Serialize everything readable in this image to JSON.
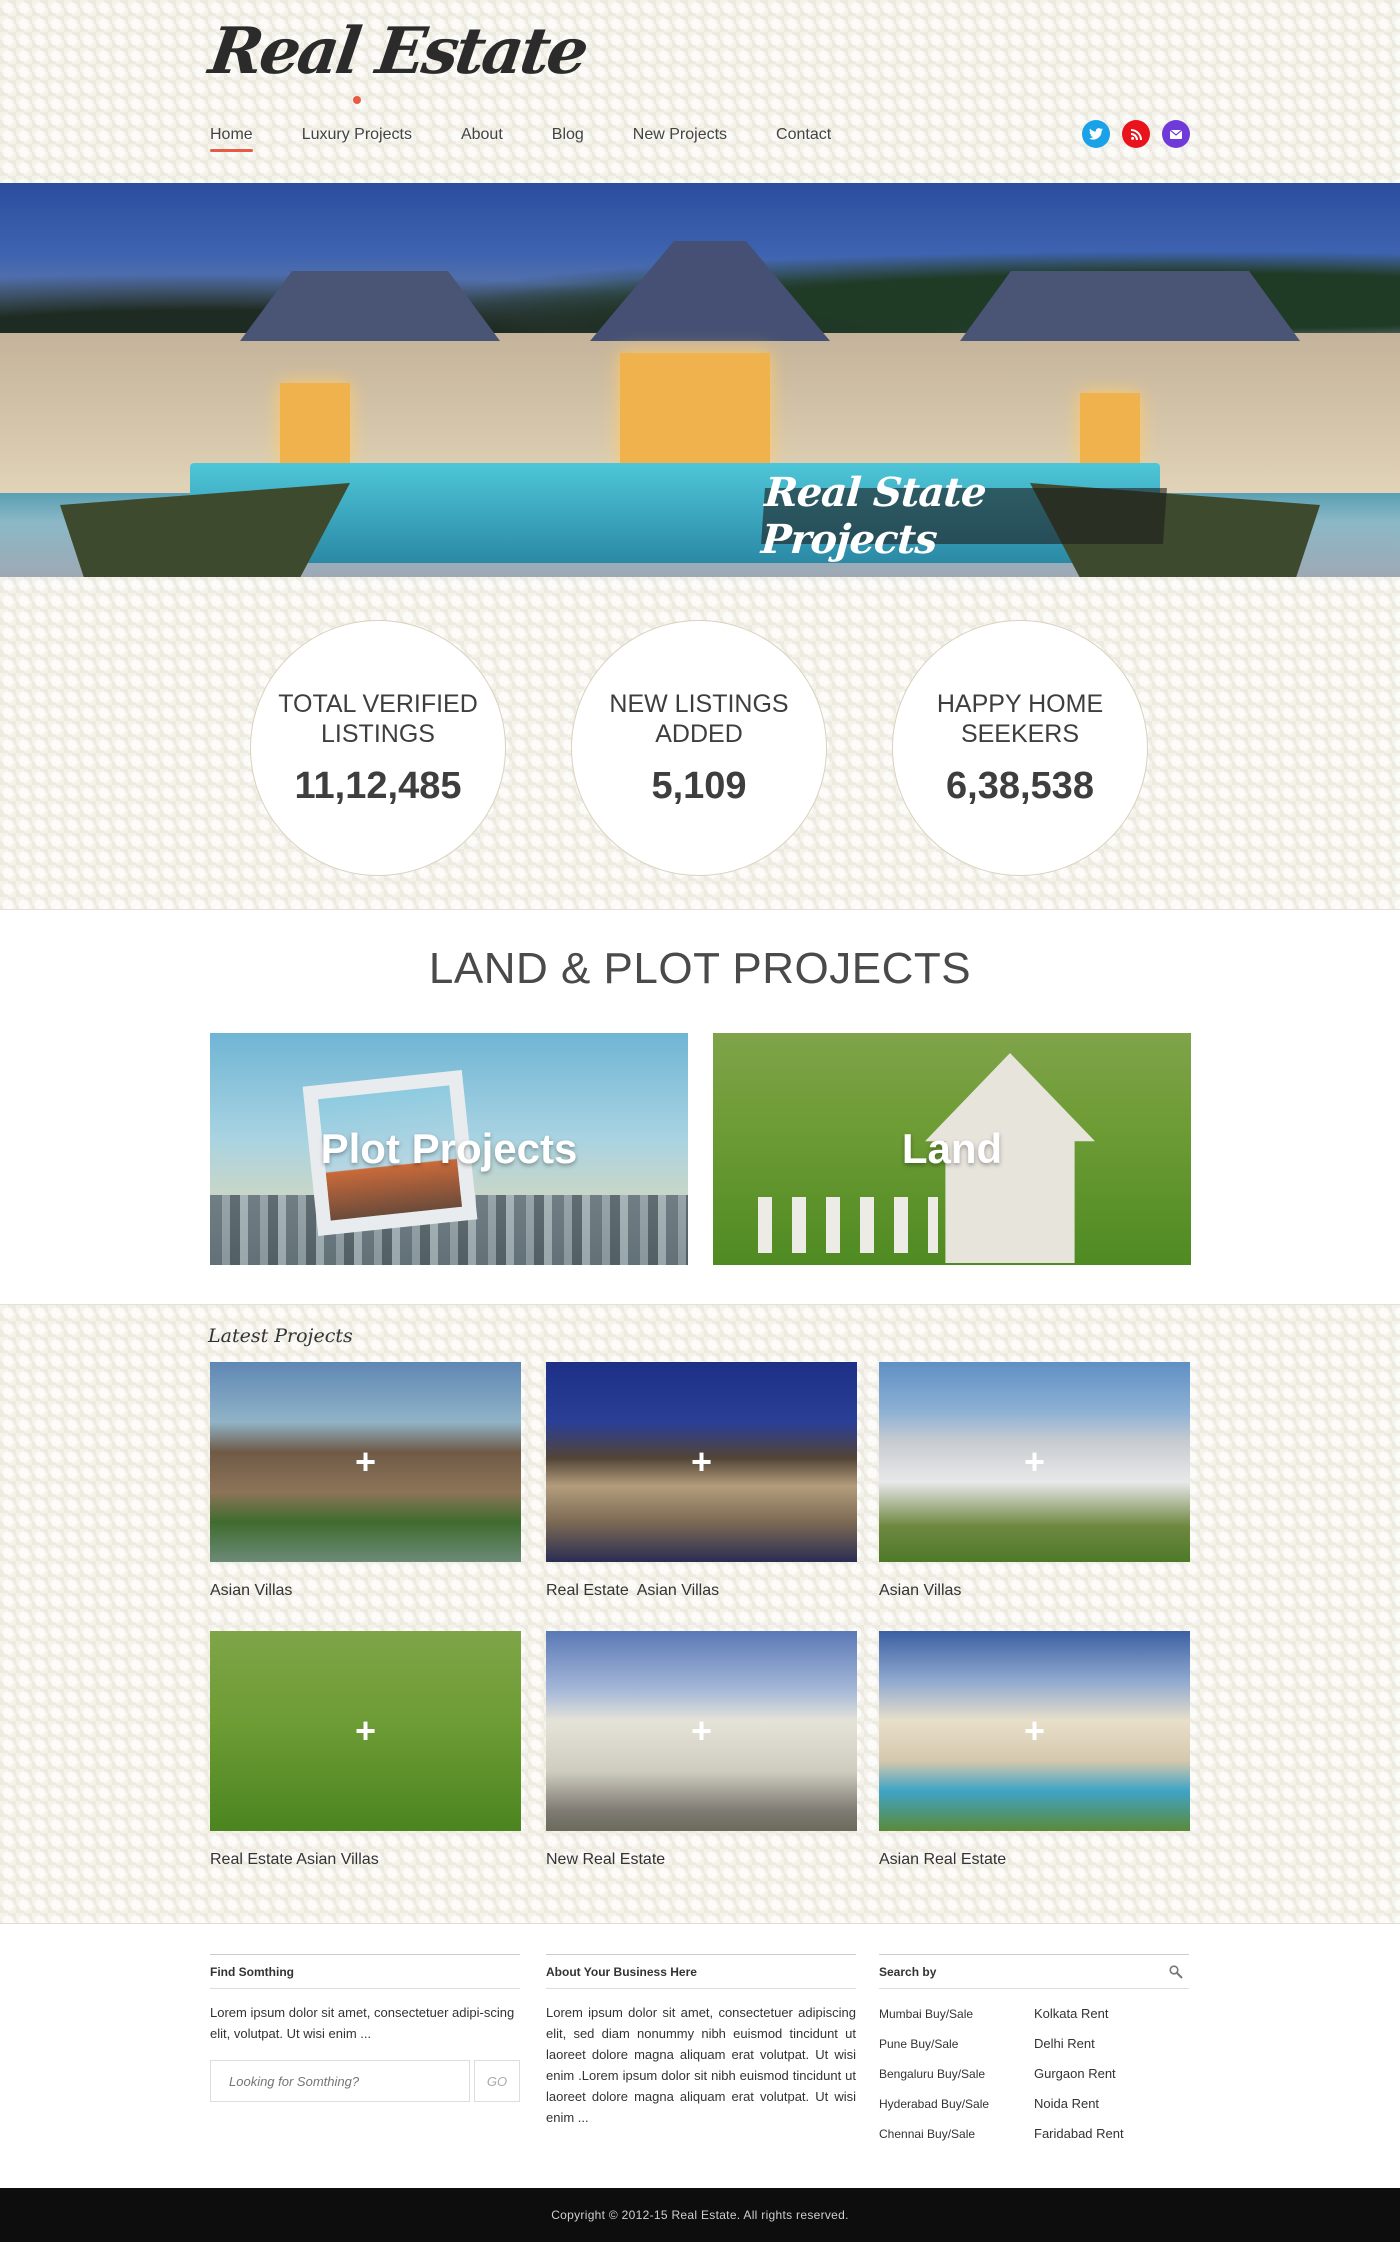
{
  "brand": {
    "logo": "Real Estate"
  },
  "nav": {
    "items": [
      "Home",
      "Luxury Projects",
      "About",
      "Blog",
      "New Projects",
      "Contact"
    ],
    "active": "Home"
  },
  "social": [
    "twitter-icon",
    "rss-icon",
    "mail-icon"
  ],
  "colors": {
    "accent": "#e85a42",
    "twitter": "#1aa2e8",
    "rss": "#e8131b",
    "mail": "#6f3ad8",
    "footer": "#0d0d0d"
  },
  "hero": {
    "banner": "Real State Projects"
  },
  "stats": [
    {
      "label": "TOTAL VERIFIED LISTINGS",
      "value": "11,12,485"
    },
    {
      "label": "NEW LISTINGS ADDED",
      "value": "5,109"
    },
    {
      "label": "HAPPY HOME SEEKERS",
      "value": "6,38,538"
    }
  ],
  "land_section": {
    "heading": "LAND & PLOT PROJECTS",
    "cards": [
      "Plot Projects",
      "Land"
    ]
  },
  "latest": {
    "heading": "Latest Projects",
    "items": [
      "Asian Villas",
      "Real Estate  Asian Villas",
      "Asian Villas",
      "Real Estate Asian Villas",
      "New Real Estate",
      "Asian Real Estate"
    ]
  },
  "footer": {
    "find": {
      "title": "Find Somthing",
      "text": "Lorem ipsum dolor sit amet, consectetuer adipi-scing elit, volutpat. Ut wisi enim ...",
      "placeholder": "Looking for Somthing?",
      "go": "GO"
    },
    "about": {
      "title": "About Your Business Here",
      "text": "Lorem ipsum dolor sit amet, consectetuer adipiscing elit, sed diam nonummy nibh euismod tincidunt ut laoreet dolore magna aliquam erat volutpat. Ut wisi enim .Lorem ipsum dolor sit  nibh euismod tincidunt ut laoreet dolore magna aliquam erat volutpat. Ut wisi enim ..."
    },
    "search_by": {
      "title": "Search by",
      "left": [
        "Mumbai Buy/Sale",
        "Pune Buy/Sale",
        "Bengaluru Buy/Sale",
        "Hyderabad Buy/Sale",
        "Chennai Buy/Sale"
      ],
      "right": [
        "Kolkata Rent",
        "Delhi Rent",
        "Gurgaon Rent",
        "Noida Rent",
        "Faridabad Rent"
      ]
    },
    "copyright": "Copyright © 2012-15 Real Estate. All rights reserved."
  }
}
